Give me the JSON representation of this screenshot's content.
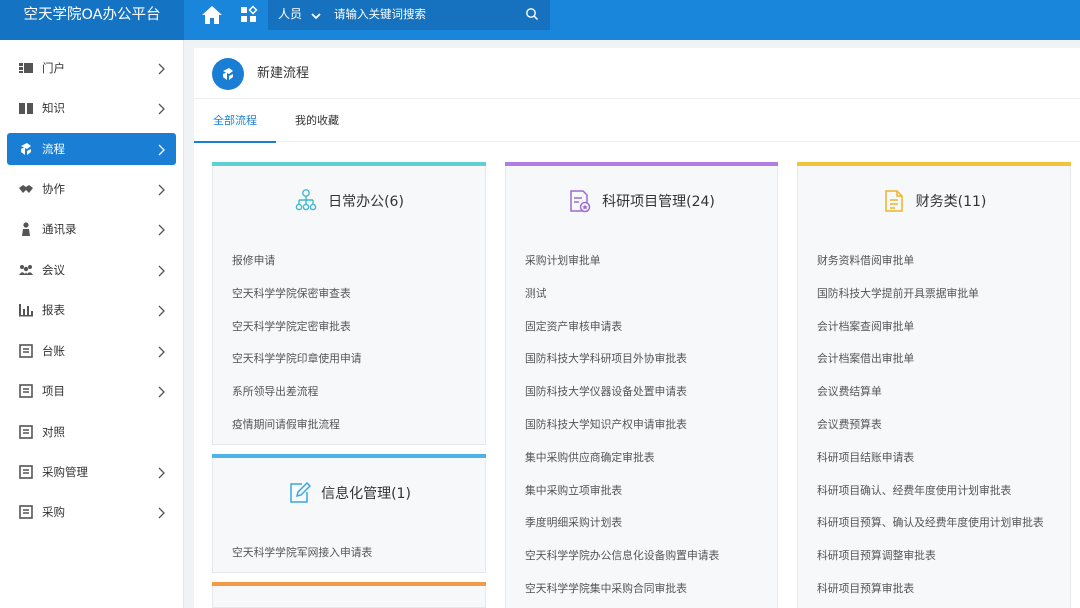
{
  "app": {
    "title": "空天学院OA办公平台"
  },
  "search": {
    "scope": "人员",
    "placeholder": "请输入关键词搜索"
  },
  "sidebar": {
    "items": [
      {
        "label": "门户",
        "icon": "portal-icon",
        "active": false
      },
      {
        "label": "知识",
        "icon": "book-icon",
        "active": false
      },
      {
        "label": "流程",
        "icon": "workflow-icon",
        "active": true
      },
      {
        "label": "协作",
        "icon": "handshake-icon",
        "active": false
      },
      {
        "label": "通讯录",
        "icon": "contacts-icon",
        "active": false
      },
      {
        "label": "会议",
        "icon": "meeting-icon",
        "active": false
      },
      {
        "label": "报表",
        "icon": "report-icon",
        "active": false
      },
      {
        "label": "台账",
        "icon": "ledger-icon",
        "active": false
      },
      {
        "label": "项目",
        "icon": "project-icon",
        "active": false
      },
      {
        "label": "对照",
        "icon": "compare-icon",
        "active": false
      },
      {
        "label": "采购管理",
        "icon": "procurement-icon",
        "active": false
      },
      {
        "label": "采购",
        "icon": "purchase-icon",
        "active": false
      }
    ]
  },
  "main": {
    "title": "新建流程",
    "tabs": [
      {
        "label": "全部流程",
        "active": true
      },
      {
        "label": "我的收藏",
        "active": false
      }
    ],
    "cards": [
      {
        "title": "日常办公(6)",
        "accent": "#5dd0d2",
        "icon": "org-chart-icon",
        "items": [
          "报修申请",
          "空天科学学院保密审查表",
          "空天科学学院定密审批表",
          "空天科学学院印章使用申请",
          "系所领导出差流程",
          "疫情期间请假审批流程"
        ]
      },
      {
        "title": "信息化管理(1)",
        "accent": "#4db3e8",
        "icon": "edit-icon",
        "items": [
          "空天科学学院军网接入申请表"
        ]
      },
      {
        "title": "科研项目管理(24)",
        "accent": "#b07ee0",
        "icon": "research-doc-icon",
        "items": [
          "采购计划审批单",
          "测试",
          "固定资产审核申请表",
          "国防科技大学科研项目外协审批表",
          "国防科技大学仪器设备处置申请表",
          "国防科技大学知识产权申请审批表",
          "集中采购供应商确定审批表",
          "集中采购立项审批表",
          "季度明细采购计划表",
          "空天科学学院办公信息化设备购置申请表",
          "空天科学学院集中采购合同审批表"
        ]
      },
      {
        "title": "财务类(11)",
        "accent": "#f2c23d",
        "icon": "finance-doc-icon",
        "items": [
          "财务资料借阅审批单",
          "国防科技大学提前开具票据审批单",
          "会计档案查阅审批单",
          "会计档案借出审批单",
          "会议费结算单",
          "会议费预算表",
          "科研项目结账申请表",
          "科研项目确认、经费年度使用计划审批表",
          "科研项目预算、确认及经费年度使用计划审批表",
          "科研项目预算调整审批表",
          "科研项目预算审批表"
        ]
      },
      {
        "title": "",
        "accent": "#f39a4a",
        "items": []
      }
    ]
  }
}
